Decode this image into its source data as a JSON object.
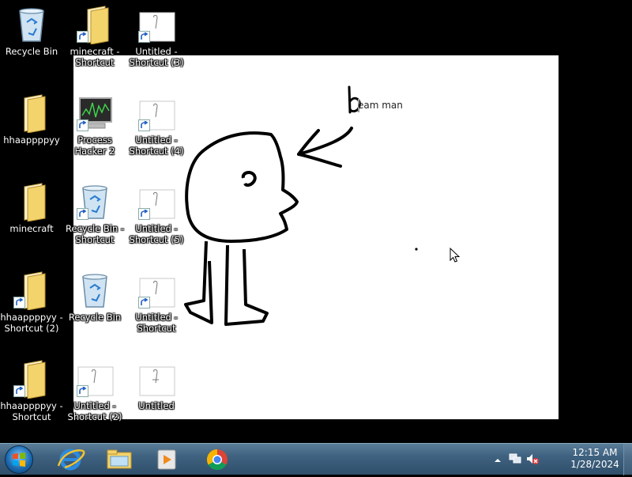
{
  "wallpaper": {
    "caption": "eam man"
  },
  "desktop_icons": [
    {
      "label": "Recycle Bin",
      "icon": "recycle-bin-icon"
    },
    {
      "label": "minecraft - Shortcut",
      "icon": "folder-shortcut-icon"
    },
    {
      "label": "Untitled - Shortcut (3)",
      "icon": "image-shortcut-icon"
    },
    {
      "label": "hhaappppyy",
      "icon": "folder-icon"
    },
    {
      "label": "Process Hacker 2",
      "icon": "process-hacker-icon"
    },
    {
      "label": "Untitled - Shortcut (4)",
      "icon": "image-shortcut-icon"
    },
    {
      "label": "minecraft",
      "icon": "folder-icon"
    },
    {
      "label": "Recycle Bin - Shortcut",
      "icon": "recycle-bin-shortcut-icon"
    },
    {
      "label": "Untitled - Shortcut (5)",
      "icon": "image-shortcut-icon"
    },
    {
      "label": "hhaappppyy - Shortcut (2)",
      "icon": "folder-shortcut-icon"
    },
    {
      "label": "Recycle Bin",
      "icon": "recycle-bin-icon"
    },
    {
      "label": "Untitled - Shortcut",
      "icon": "image-shortcut-icon"
    },
    {
      "label": "hhaappppyy - Shortcut",
      "icon": "folder-shortcut-icon"
    },
    {
      "label": "Untitled - Shortcut (2)",
      "icon": "image-shortcut-icon"
    },
    {
      "label": "Untitled",
      "icon": "image-icon"
    }
  ],
  "taskbar": {
    "pinned": [
      "internet-explorer-icon",
      "windows-explorer-icon",
      "media-player-icon",
      "chrome-icon"
    ],
    "clock": {
      "time": "12:15 AM",
      "date": "1/28/2024"
    }
  },
  "colors": {
    "desktop_bg": "#000000",
    "taskbar_top": "#5a7d9a",
    "taskbar_bottom": "#2f4f6b",
    "folder_yellow": "#f3d36b"
  }
}
